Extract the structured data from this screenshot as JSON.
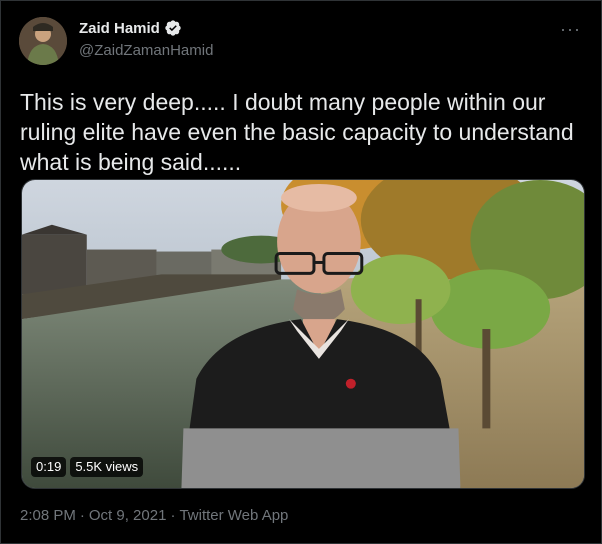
{
  "author": {
    "display_name": "Zaid Hamid",
    "handle": "@ZaidZamanHamid",
    "verified": true
  },
  "menu": {
    "more_label": "···"
  },
  "tweet": {
    "text": "This is very deep..... I doubt many people within our ruling elite have even the basic capacity to understand what is being said......"
  },
  "video": {
    "duration": "0:19",
    "views": "5.5K views"
  },
  "footer": {
    "time": "2:08 PM",
    "sep1": "·",
    "date": "Oct 9, 2021",
    "sep2": "·",
    "source": "Twitter Web App"
  },
  "colors": {
    "background": "#000000",
    "text": "#e7e9ea",
    "muted": "#71767b",
    "verified": "#1d9bf0"
  }
}
